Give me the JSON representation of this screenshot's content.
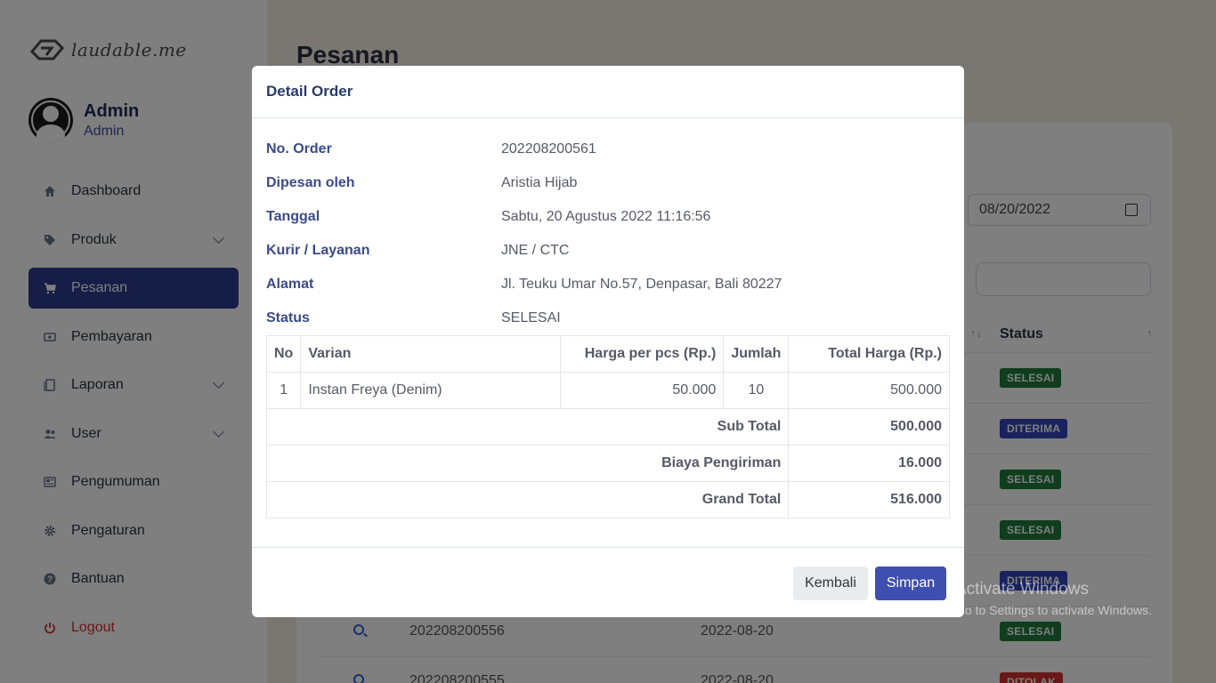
{
  "sidebar": {
    "logo_text": "laudable.me",
    "profile": {
      "name": "Admin",
      "role": "Admin"
    },
    "items": [
      {
        "label": "Dashboard",
        "icon": "home-icon"
      },
      {
        "label": "Produk",
        "icon": "tag-icon"
      },
      {
        "label": "Pesanan",
        "icon": "cart-icon"
      },
      {
        "label": "Pembayaran",
        "icon": "money-icon"
      },
      {
        "label": "Laporan",
        "icon": "document-icon"
      },
      {
        "label": "User",
        "icon": "users-icon"
      },
      {
        "label": "Pengumuman",
        "icon": "newspaper-icon"
      },
      {
        "label": "Pengaturan",
        "icon": "gear-icon"
      },
      {
        "label": "Bantuan",
        "icon": "question-icon"
      },
      {
        "label": "Logout",
        "icon": "power-icon"
      }
    ]
  },
  "main": {
    "title": "Pesanan",
    "date_filter": "08/20/2022",
    "search_label": ":",
    "status_header": "Status",
    "rows": [
      {
        "status": "SELESAI"
      },
      {
        "status": "DITERIMA"
      },
      {
        "status": "SELESAI"
      },
      {
        "status": "SELESAI"
      },
      {
        "status": "DITERIMA"
      },
      {
        "order": "202208200556",
        "date": "2022-08-20",
        "status": "SELESAI"
      },
      {
        "order": "202208200555",
        "date": "2022-08-20",
        "status": "DITOLAK"
      }
    ]
  },
  "modal": {
    "title": "Detail Order",
    "info": [
      {
        "label": "No. Order",
        "value": "202208200561"
      },
      {
        "label": "Dipesan oleh",
        "value": "Aristia Hijab"
      },
      {
        "label": "Tanggal",
        "value": "Sabtu, 20 Agustus 2022 11:16:56"
      },
      {
        "label": "Kurir / Layanan",
        "value": "JNE / CTC"
      },
      {
        "label": "Alamat",
        "value": "Jl. Teuku Umar No.57, Denpasar, Bali 80227"
      },
      {
        "label": "Status",
        "value": "SELESAI"
      }
    ],
    "table": {
      "headers": [
        "No",
        "Varian",
        "Harga per pcs (Rp.)",
        "Jumlah",
        "Total Harga (Rp.)"
      ],
      "rows": [
        {
          "no": "1",
          "varian": "Instan Freya (Denim)",
          "harga": "50.000",
          "jumlah": "10",
          "total": "500.000"
        }
      ],
      "sub_total_label": "Sub Total",
      "sub_total": "500.000",
      "shipping_label": "Biaya Pengiriman",
      "shipping": "16.000",
      "grand_total_label": "Grand Total",
      "grand_total": "516.000"
    },
    "buttons": {
      "back": "Kembali",
      "save": "Simpan"
    }
  },
  "watermark": {
    "title": "Activate Windows",
    "subtitle": "Go to Settings to activate Windows."
  }
}
